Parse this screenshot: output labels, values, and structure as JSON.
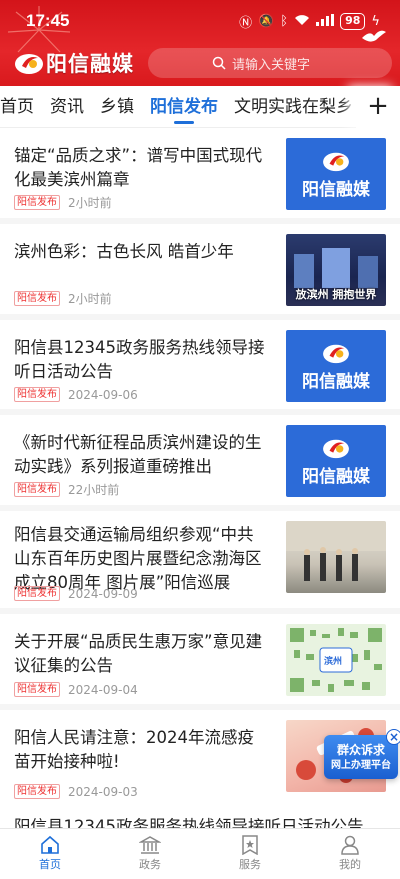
{
  "status_bar": {
    "time": "17:45",
    "battery": "98"
  },
  "header": {
    "app_name": "阳信融媒",
    "search_placeholder": "请输入关键字"
  },
  "tabs": [
    {
      "label": "首页"
    },
    {
      "label": "资讯"
    },
    {
      "label": "乡镇"
    },
    {
      "label": "阳信发布",
      "active": true
    },
    {
      "label": "文明实践在梨乡"
    }
  ],
  "tab_more_label": "+",
  "articles": [
    {
      "title": "锚定“品质之求”：谱写中国式现代化最美滨州篇章",
      "tag": "阳信发布",
      "time": "2小时前",
      "thumb": "brand"
    },
    {
      "title": "滨州色彩：古色长风  皓首少年",
      "tag": "阳信发布",
      "time": "2小时前",
      "thumb": "photo",
      "thumb_caption": "放滨州 拥抱世界"
    },
    {
      "title": "阳信县12345政务服务热线领导接听日活动公告",
      "tag": "阳信发布",
      "time": "2024-09-06",
      "thumb": "brand"
    },
    {
      "title": "《新时代新征程品质滨州建设的生动实践》系列报道重磅推出",
      "tag": "阳信发布",
      "time": "22小时前",
      "thumb": "brand"
    },
    {
      "title": "阳信县交通运输局组织参观“中共山东百年历史图片展暨纪念渤海区成立80周年  图片展”阳信巡展",
      "tag": "阳信发布",
      "time": "2024-09-09",
      "thumb": "photo"
    },
    {
      "title": "关于开展“品质民生惠万家”意见建议征集的公告",
      "tag": "阳信发布",
      "time": "2024-09-04",
      "thumb": "qr",
      "thumb_caption": "滨州"
    },
    {
      "title": "阳信人民请注意：2024年流感疫苗开始接种啦!",
      "tag": "阳信发布",
      "time": "2024-09-03",
      "thumb": "flu"
    }
  ],
  "thumb_brand_text": "阳信融媒",
  "partial_article_title": "阳信县12345政务服务热线领导接听日活动公告",
  "floating_banner": {
    "line1": "群众诉求",
    "line2": "网上办理平台",
    "close": "×"
  },
  "bottom_nav": [
    {
      "label": "首页",
      "icon": "home-icon",
      "active": true
    },
    {
      "label": "政务",
      "icon": "government-icon"
    },
    {
      "label": "服务",
      "icon": "service-icon"
    },
    {
      "label": "我的",
      "icon": "user-icon"
    }
  ],
  "colors": {
    "header_red": "#d9191d",
    "accent_blue": "#1e6fd9",
    "tag_red": "#e33333"
  }
}
